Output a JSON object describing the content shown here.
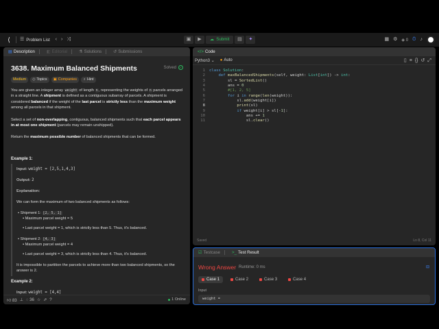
{
  "nav": {
    "problem_list": "Problem List",
    "submit": "Submit",
    "streak": "0"
  },
  "left_tabs": {
    "description": "Description",
    "editorial": "Editorial",
    "solutions": "Solutions",
    "submissions": "Submissions"
  },
  "problem": {
    "title": "3638. Maximum Balanced Shipments",
    "status": "Solved",
    "difficulty": "Medium",
    "topics": "Topics",
    "companies": "Companies",
    "hint": "Hint",
    "p1_a": "You are given an integer array ",
    "p1_code1": "weight",
    "p1_b": " of length ",
    "p1_code2": "n",
    "p1_c": ", representing the weights of ",
    "p1_code3": "n",
    "p1_d": " parcels arranged in a straight line. A ",
    "p1_bold1": "shipment",
    "p1_e": " is defined as a contiguous subarray of parcels. A shipment is considered ",
    "p1_bold2": "balanced",
    "p1_f": " if the weight of the ",
    "p1_bold3": "last parcel",
    "p1_g": " is ",
    "p1_bold4": "strictly less",
    "p1_h": " than the ",
    "p1_bold5": "maximum weight",
    "p1_i": " among all parcels in that shipment.",
    "p2_a": "Select a set of ",
    "p2_bold1": "non-overlapping",
    "p2_b": ", contiguous, balanced shipments such that ",
    "p2_bold2": "each parcel appears in at most one shipment",
    "p2_c": " (parcels may remain unshipped).",
    "p3_a": "Return the ",
    "p3_bold": "maximum possible number",
    "p3_b": " of balanced shipments that can be formed.",
    "example1": "Example 1:",
    "input_label": "Input:",
    "input_value": "weight = [2,5,1,4,3]",
    "output_label": "Output:",
    "output_value": "2",
    "explanation_label": "Explanation:",
    "explanation_text": "We can form the maximum of two balanced shipments as follows:",
    "ship1_label": "Shipment 1: ",
    "ship1_code": "[2, 5, 1]",
    "ship1_max": "Maximum parcel weight = 5",
    "ship1_last": "Last parcel weight = 1, which is strictly less than 5. Thus, it's balanced.",
    "ship2_label": "Shipment 2: ",
    "ship2_code": "[4, 3]",
    "ship2_max": "Maximum parcel weight = 4",
    "ship2_last": "Last parcel weight = 3, which is strictly less than 4. Thus, it's balanced.",
    "conclusion": "It is impossible to partition the parcels to achieve more than two balanced shipments, so the answer is 2.",
    "example2": "Example 2:",
    "input2_value": "weight = [4,4]"
  },
  "left_footer": {
    "likes": "83",
    "comments": "36",
    "online": "1 Online"
  },
  "editor": {
    "tab": "Code",
    "language": "Python3",
    "mode": "Auto",
    "line_numbers": [
      "1",
      "2",
      "3",
      "4",
      "5",
      "6",
      "7",
      "8",
      "9",
      "10",
      "11"
    ],
    "status": "Saved",
    "position": "Ln 8, Col 11",
    "lines": [
      "class Solution:",
      "    def maxBalancedShipments(self, weight: List[int]) -> int:",
      "        sl = SortedList()",
      "        ans = 0",
      "        #[1, 2, 5]",
      "        for i in range(len(weight)):",
      "            sl.add(weight[i])",
      "            print(sl)",
      "            if weight[i] > sl[-1]:",
      "                ans += 1",
      "                sl.clear()"
    ]
  },
  "console": {
    "testcase_tab": "Testcase",
    "result_tab": "Test Result",
    "verdict": "Wrong Answer",
    "runtime": "Runtime: 0 ms",
    "cases": [
      "Case 1",
      "Case 2",
      "Case 3",
      "Case 4"
    ],
    "input_label": "Input",
    "input_value": "weight ="
  }
}
